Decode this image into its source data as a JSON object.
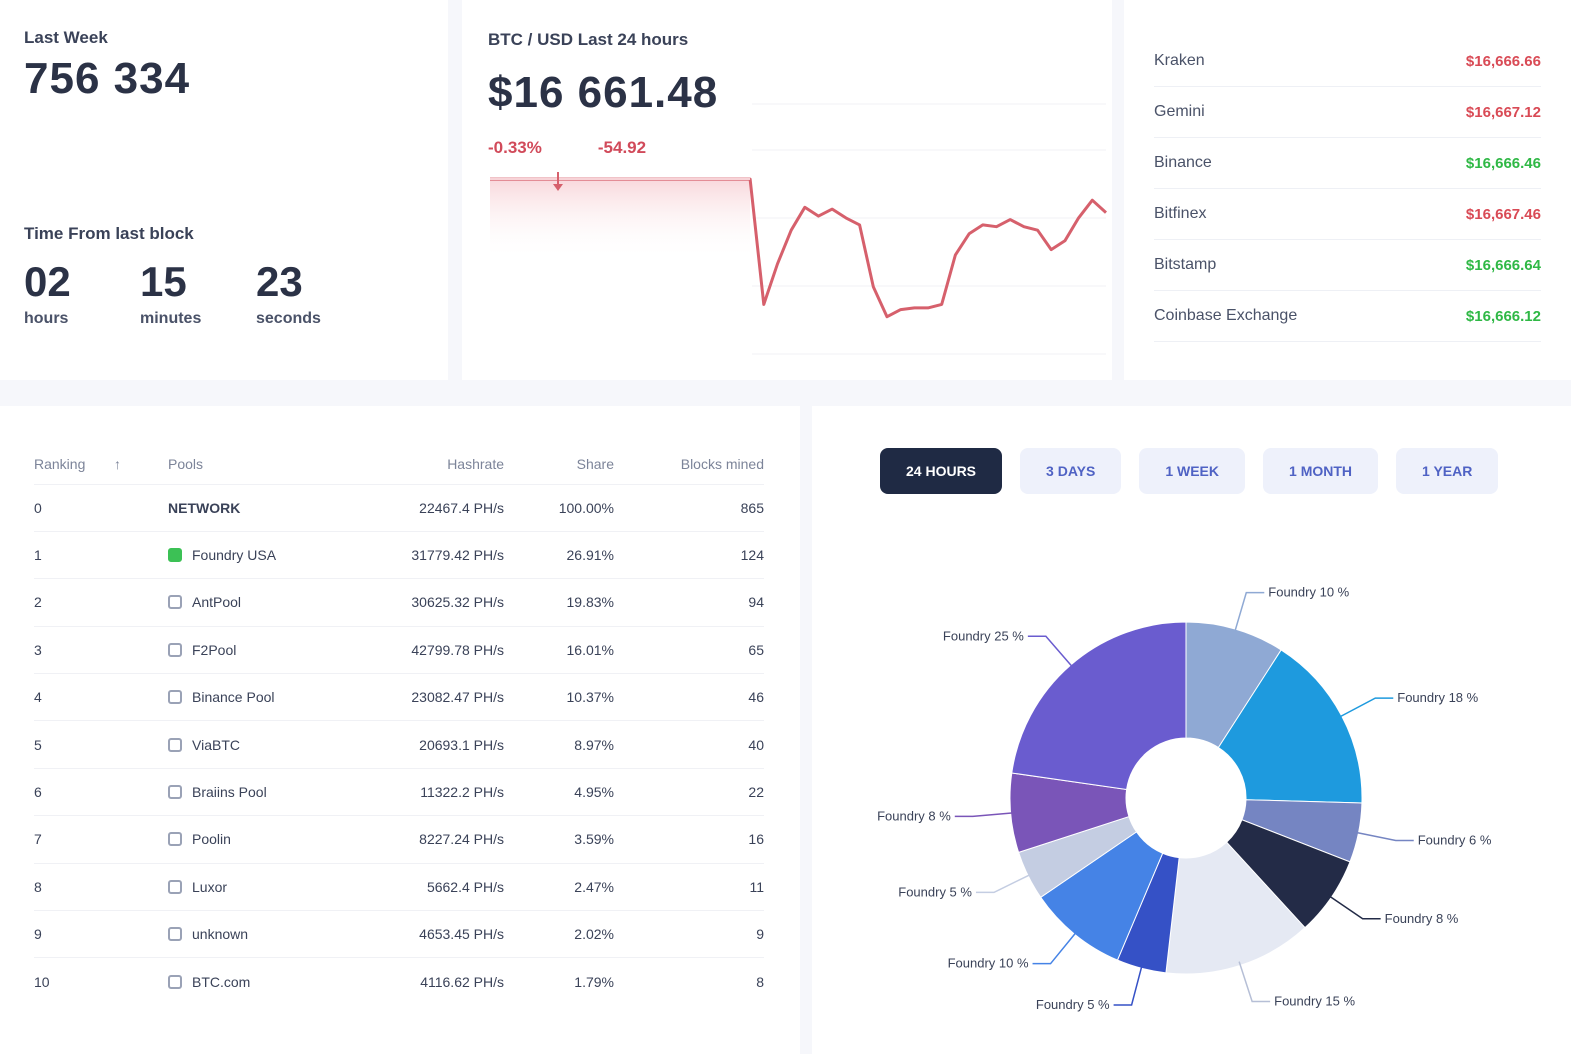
{
  "last_week": {
    "label": "Last Week",
    "value": "756 334",
    "timer_title": "Time From last block",
    "hours": "02",
    "hours_label": "hours",
    "minutes": "15",
    "minutes_label": "minutes",
    "seconds": "23",
    "seconds_label": "seconds"
  },
  "btc": {
    "title": "BTC / USD Last 24 hours",
    "price": "$16 661.48",
    "change_pct": "-0.33%",
    "change_abs": "-54.92",
    "line_color": "#d6606c"
  },
  "exchanges": [
    {
      "name": "Kraken",
      "price": "$16,666.66",
      "trend": "down"
    },
    {
      "name": "Gemini",
      "price": "$16,667.12",
      "trend": "down"
    },
    {
      "name": "Binance",
      "price": "$16,666.46",
      "trend": "up"
    },
    {
      "name": "Bitfinex",
      "price": "$16,667.46",
      "trend": "down"
    },
    {
      "name": "Bitstamp",
      "price": "$16,666.64",
      "trend": "up"
    },
    {
      "name": "Coinbase Exchange",
      "price": "$16,666.12",
      "trend": "up"
    }
  ],
  "pools_table": {
    "headers": {
      "ranking": "Ranking",
      "pool": "Pools",
      "hashrate": "Hashrate",
      "share": "Share",
      "blocks": "Blocks mined"
    },
    "rows": [
      {
        "rank": "0",
        "pool": "NETWORK",
        "hashrate": "22467.4 PH/s",
        "share": "100.00%",
        "blocks": "865",
        "icon": "none"
      },
      {
        "rank": "1",
        "pool": "Foundry USA",
        "hashrate": "31779.42 PH/s",
        "share": "26.91%",
        "blocks": "124",
        "icon": "active"
      },
      {
        "rank": "2",
        "pool": "AntPool",
        "hashrate": "30625.32 PH/s",
        "share": "19.83%",
        "blocks": "94",
        "icon": "inactive"
      },
      {
        "rank": "3",
        "pool": "F2Pool",
        "hashrate": "42799.78 PH/s",
        "share": "16.01%",
        "blocks": "65",
        "icon": "inactive"
      },
      {
        "rank": "4",
        "pool": "Binance Pool",
        "hashrate": "23082.47 PH/s",
        "share": "10.37%",
        "blocks": "46",
        "icon": "inactive"
      },
      {
        "rank": "5",
        "pool": "ViaBTC",
        "hashrate": "20693.1 PH/s",
        "share": "8.97%",
        "blocks": "40",
        "icon": "inactive"
      },
      {
        "rank": "6",
        "pool": "Braiins Pool",
        "hashrate": "11322.2 PH/s",
        "share": "4.95%",
        "blocks": "22",
        "icon": "inactive"
      },
      {
        "rank": "7",
        "pool": "Poolin",
        "hashrate": "8227.24 PH/s",
        "share": "3.59%",
        "blocks": "16",
        "icon": "inactive"
      },
      {
        "rank": "8",
        "pool": "Luxor",
        "hashrate": "5662.4 PH/s",
        "share": "2.47%",
        "blocks": "11",
        "icon": "inactive"
      },
      {
        "rank": "9",
        "pool": "unknown",
        "hashrate": "4653.45 PH/s",
        "share": "2.02%",
        "blocks": "9",
        "icon": "inactive"
      },
      {
        "rank": "10",
        "pool": "BTC.com",
        "hashrate": "4116.62 PH/s",
        "share": "1.79%",
        "blocks": "8",
        "icon": "inactive"
      }
    ]
  },
  "pie_tabs": [
    "24 HOURS",
    "3 DAYS",
    "1 WEEK",
    "1 MONTH",
    "1 YEAR"
  ],
  "chart_data": {
    "type": "pie",
    "slices": [
      {
        "label": "Foundry 10 %",
        "value": 10,
        "color": "#8fa9d4"
      },
      {
        "label": "Foundry 18 %",
        "value": 18,
        "color": "#1e9ade"
      },
      {
        "label": "Foundry 6 %",
        "value": 6,
        "color": "#7585c2"
      },
      {
        "label": "Foundry 8 %",
        "value": 8,
        "color": "#232b47"
      },
      {
        "label": "Foundry 15 %",
        "value": 15,
        "color": "#e5e9f3"
      },
      {
        "label": "Foundry 5 %",
        "value": 5,
        "color": "#3551c6"
      },
      {
        "label": "Foundry 10 %",
        "value": 10,
        "color": "#4583e6"
      },
      {
        "label": "Foundry 5 %",
        "value": 5,
        "color": "#c4cde2"
      },
      {
        "label": "Foundry 8 %",
        "value": 8,
        "color": "#7a55b8"
      },
      {
        "label": "Foundry 25 %",
        "value": 25,
        "color": "#6a5ccf"
      }
    ],
    "btc_series": [
      16716,
      16716,
      16716,
      16716,
      16716,
      16716,
      16716,
      16716,
      16716,
      16716,
      16716,
      16716,
      16716,
      16716,
      16716,
      16716,
      16716,
      16716,
      16716,
      16716,
      16645,
      16668,
      16687,
      16700,
      16695,
      16699,
      16694,
      16690,
      16655,
      16638,
      16642,
      16643,
      16643,
      16645,
      16673,
      16685,
      16690,
      16689,
      16693,
      16689,
      16687,
      16676,
      16681,
      16694,
      16704,
      16697
    ]
  }
}
